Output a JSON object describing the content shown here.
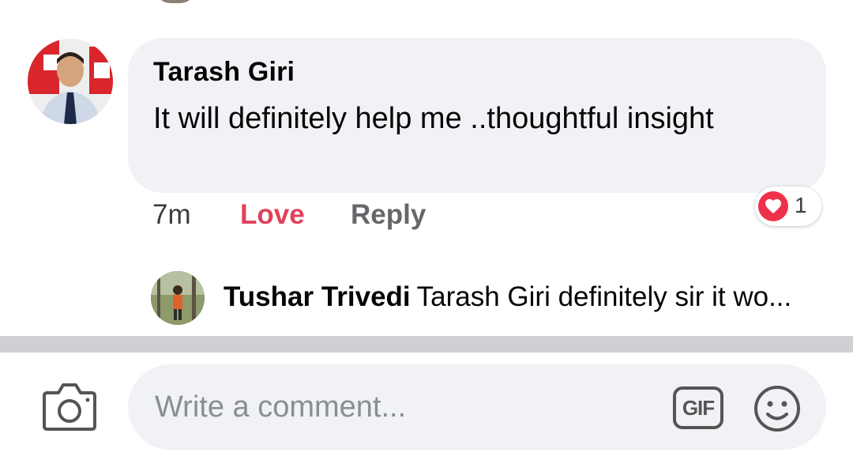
{
  "comment": {
    "author": "Tarash Giri",
    "text": "It will definitely help me ..thoughtful insight",
    "time": "7m",
    "love_label": "Love",
    "reply_label": "Reply",
    "reaction": {
      "icon": "heart-icon",
      "count": "1",
      "color": "#f0304a"
    }
  },
  "reply_preview": {
    "author": "Tushar Trivedi",
    "snippet": "Tarash Giri definitely sir it wo..."
  },
  "composer": {
    "placeholder": "Write a comment...",
    "camera_icon": "camera-icon",
    "gif_label": "GIF",
    "emoji_icon": "emoji-icon"
  },
  "colors": {
    "love": "#e0425a",
    "bubble": "#f0f2f5",
    "separator": "#ced0d4",
    "muted": "#65676b"
  }
}
